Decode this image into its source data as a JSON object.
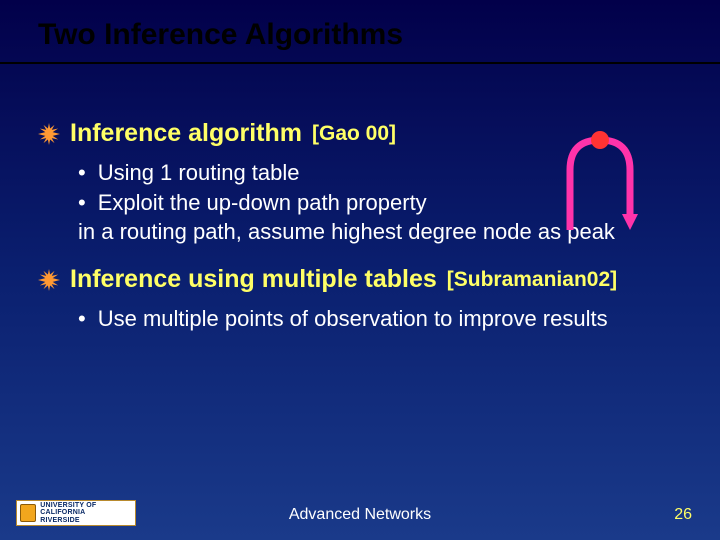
{
  "title": "Two Inference Algorithms",
  "section1": {
    "heading": "Inference algorithm",
    "cite": "[Gao 00]",
    "bullet1": "Using  1 routing table",
    "bullet2": "Exploit the up-down path property",
    "wrap": "in a routing path, assume highest degree node as peak"
  },
  "section2": {
    "heading": "Inference using multiple tables",
    "cite": "[Subramanian02]",
    "bullet1": "Use multiple points of observation to improve results"
  },
  "footer": {
    "logo_line1": "UNIVERSITY OF CALIFORNIA",
    "logo_line2": "RIVERSIDE",
    "center": "Advanced Networks",
    "page": "26"
  },
  "icons": {
    "star": "star-burst-icon",
    "peak_node": "peak-node-diagram"
  },
  "colors": {
    "accent": "#ffff66",
    "diagram": "#ff33aa",
    "node": "#ff3333"
  }
}
